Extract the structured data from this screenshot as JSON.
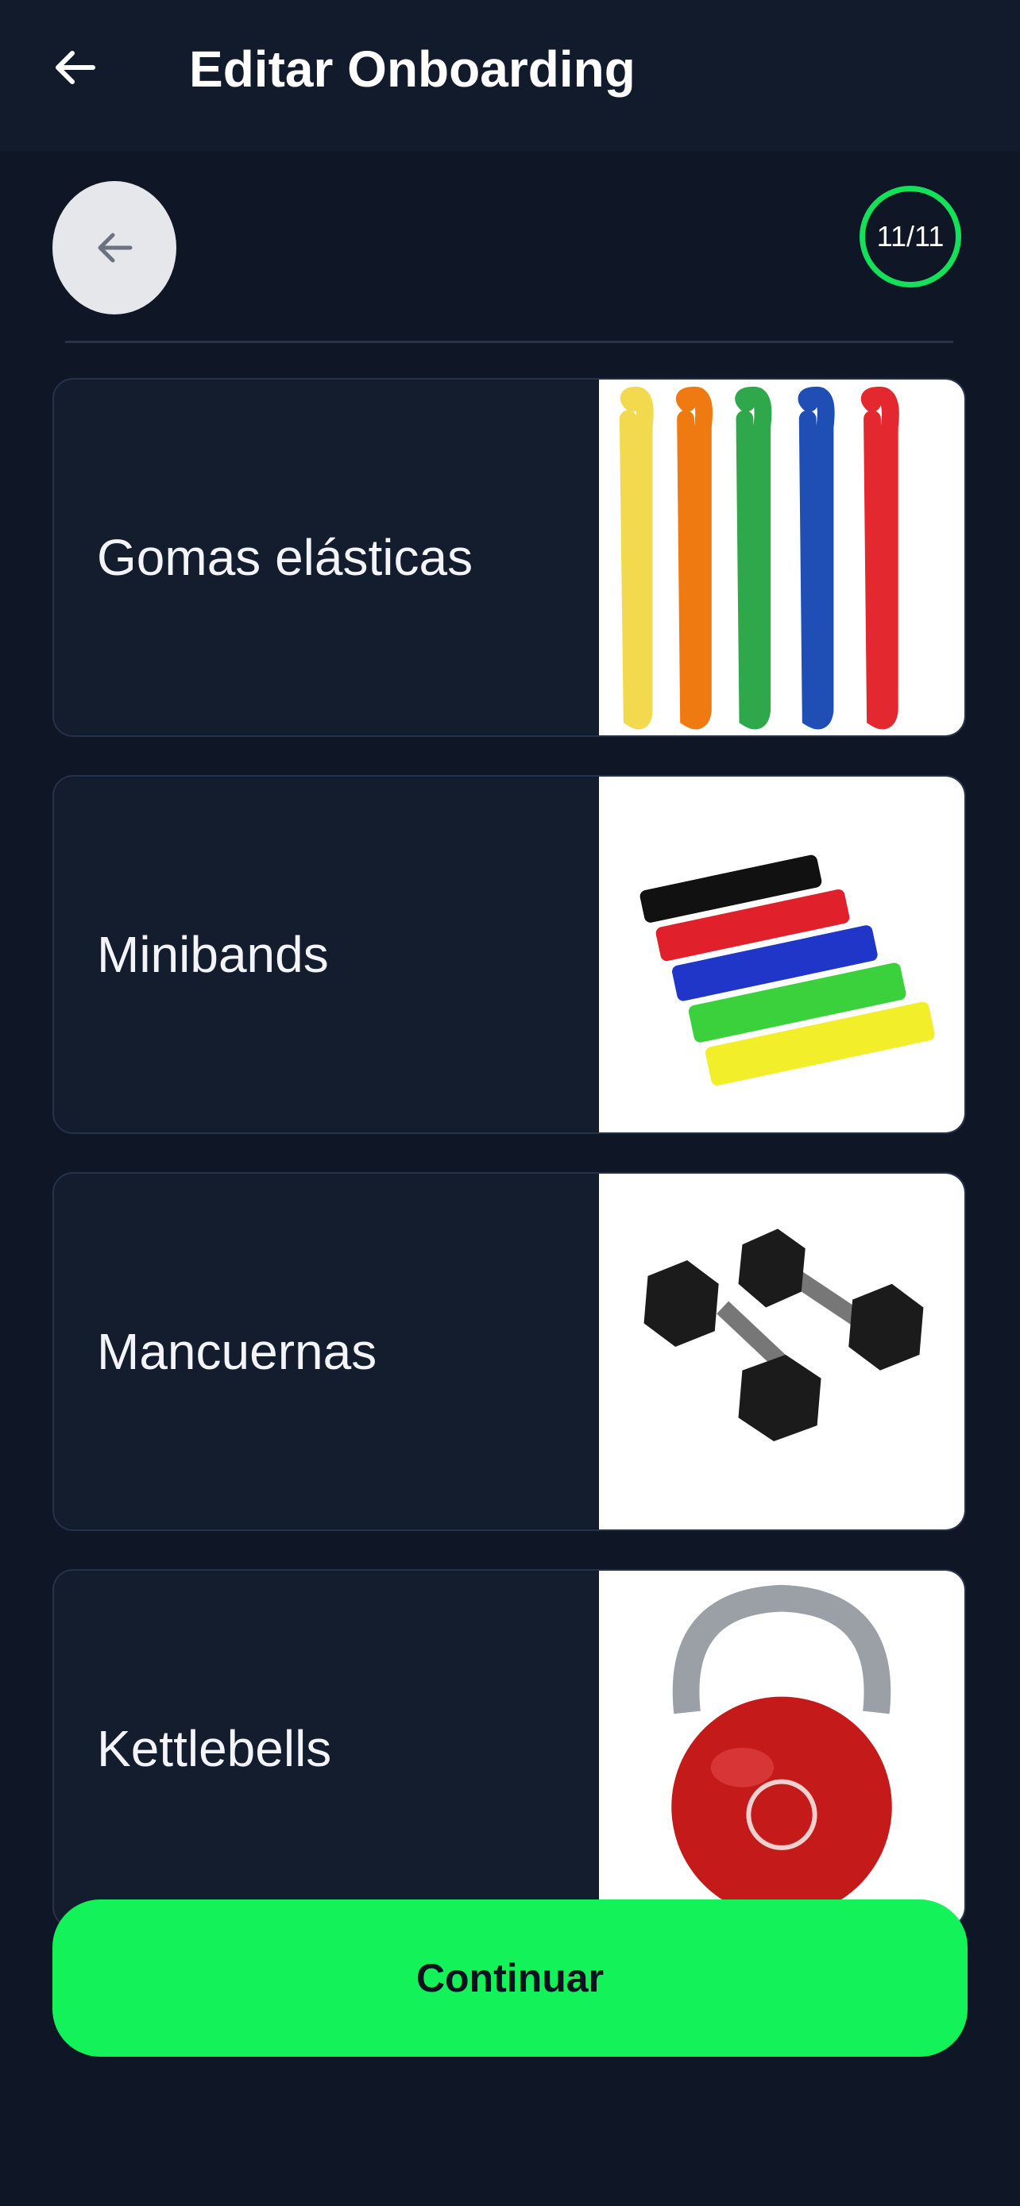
{
  "header": {
    "title": "Editar Onboarding"
  },
  "progress": {
    "counter": "11/11"
  },
  "options": [
    {
      "label": "Gomas elásticas",
      "image_icon": "resistance-bands-image"
    },
    {
      "label": "Minibands",
      "image_icon": "minibands-image"
    },
    {
      "label": "Mancuernas",
      "image_icon": "dumbbells-image"
    },
    {
      "label": "Kettlebells",
      "image_icon": "kettlebell-image"
    }
  ],
  "cta": {
    "label": "Continuar"
  },
  "colors": {
    "accent": "#14f25a",
    "background": "#0f1726",
    "card": "#141d2e"
  }
}
